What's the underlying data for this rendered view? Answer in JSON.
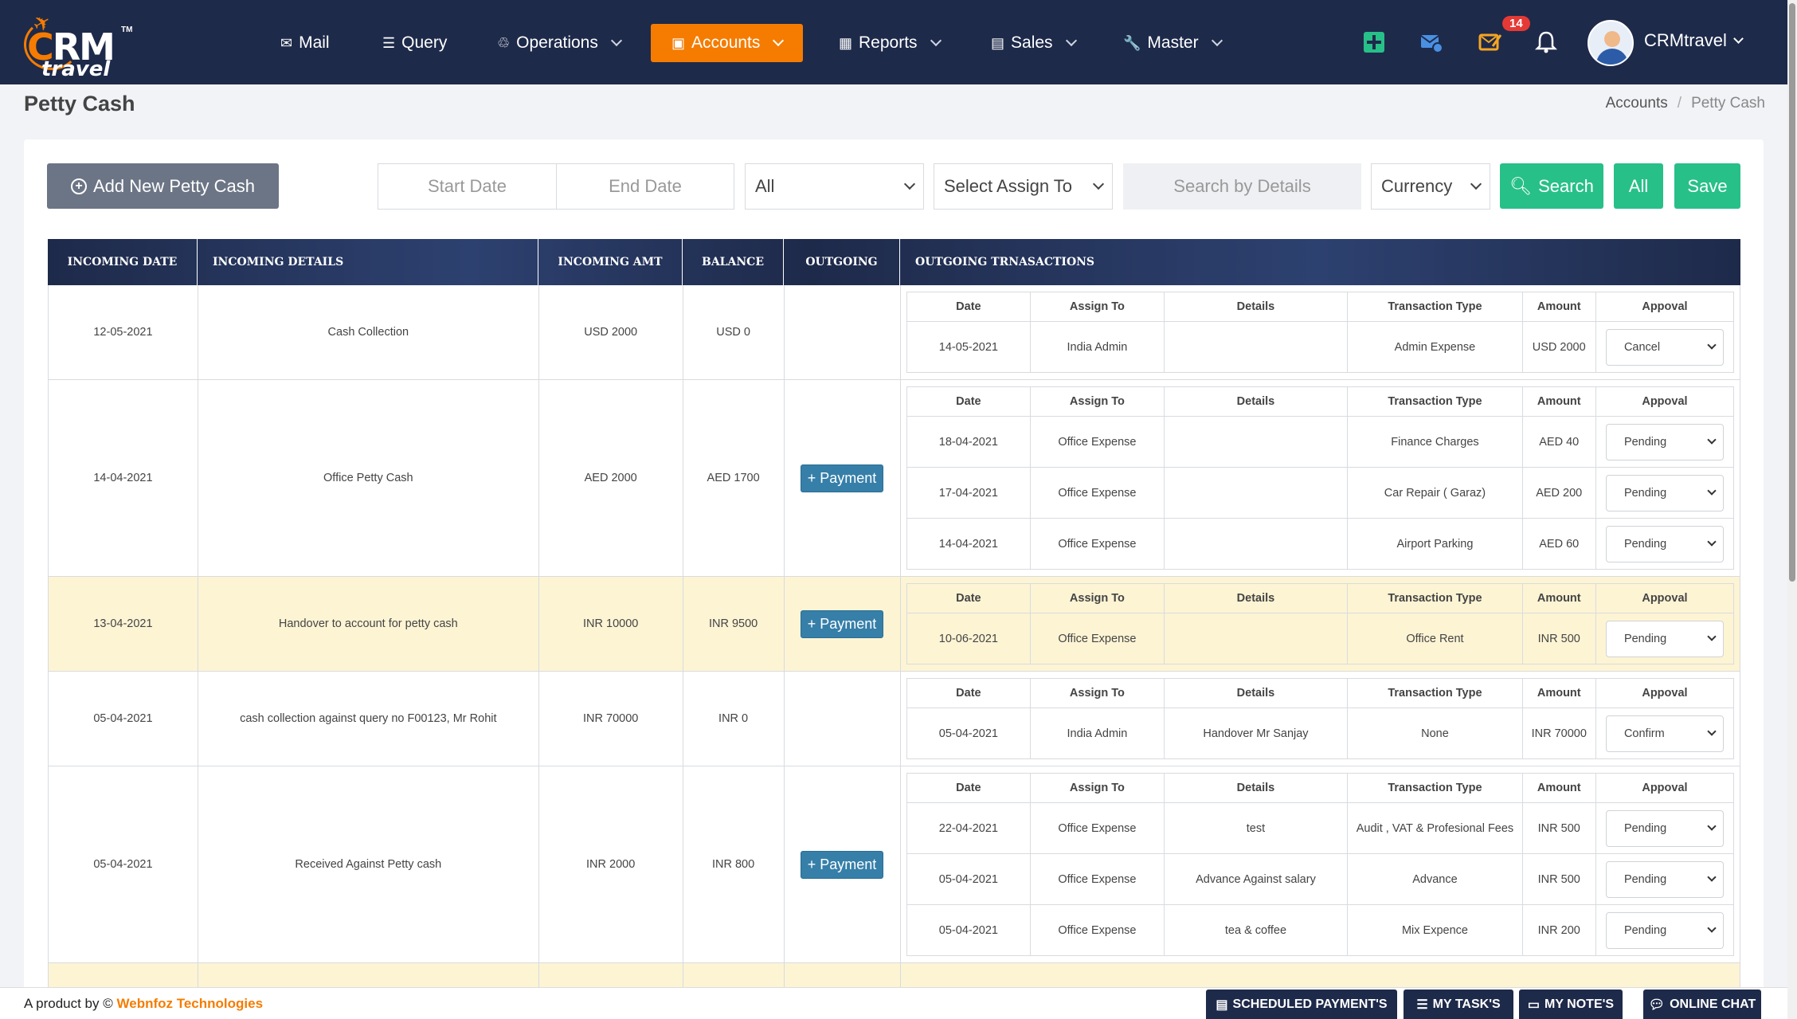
{
  "app": {
    "brand_mark": "CRM",
    "brand_sub": "travel",
    "brand_tm": "TM"
  },
  "nav": {
    "items": [
      {
        "label": "Mail",
        "icon": "mail-icon"
      },
      {
        "label": "Query",
        "icon": "list-icon"
      },
      {
        "label": "Operations",
        "icon": "recycle-icon"
      },
      {
        "label": "Accounts",
        "icon": "ledger-icon",
        "active": true
      },
      {
        "label": "Reports",
        "icon": "table-icon"
      },
      {
        "label": "Sales",
        "icon": "sales-icon"
      },
      {
        "label": "Master",
        "icon": "wrench-icon"
      }
    ],
    "notifications_count": "14",
    "user_name": "CRMtravel"
  },
  "page": {
    "title": "Petty Cash"
  },
  "breadcrumb": {
    "parent": "Accounts",
    "current": "Petty Cash"
  },
  "filters": {
    "add_label": "Add New Petty Cash",
    "start_date_placeholder": "Start Date",
    "end_date_placeholder": "End Date",
    "status_selected": "All",
    "assign_selected": "Select Assign To",
    "search_placeholder": "Search by Details",
    "currency_selected": "Currency",
    "search_label": "Search",
    "all_label": "All",
    "save_label": "Save"
  },
  "table": {
    "headers": [
      "INCOMING DATE",
      "INCOMING DETAILS",
      "INCOMING AMT",
      "BALANCE",
      "OUTGOING",
      "OUTGOING TRNASACTIONS"
    ],
    "sub_headers": [
      "Date",
      "Assign To",
      "Details",
      "Transaction Type",
      "Amount",
      "Appoval"
    ],
    "payment_label": "+ Payment",
    "rows": [
      {
        "date": "12-05-2021",
        "details": "Cash Collection",
        "amount": "USD 2000",
        "balance": "USD 0",
        "highlight": false,
        "payment": false,
        "tx": [
          [
            "14-05-2021",
            "India Admin",
            "",
            "Admin Expense",
            "USD 2000",
            "Cancel"
          ]
        ]
      },
      {
        "date": "14-04-2021",
        "details": "Office Petty Cash",
        "amount": "AED 2000",
        "balance": "AED 1700",
        "highlight": false,
        "payment": true,
        "tx": [
          [
            "18-04-2021",
            "Office Expense",
            "",
            "Finance Charges",
            "AED 40",
            "Pending"
          ],
          [
            "17-04-2021",
            "Office Expense",
            "",
            "Car Repair ( Garaz)",
            "AED 200",
            "Pending"
          ],
          [
            "14-04-2021",
            "Office Expense",
            "",
            "Airport Parking",
            "AED 60",
            "Pending"
          ]
        ]
      },
      {
        "date": "13-04-2021",
        "details": "Handover to account for petty cash",
        "amount": "INR 10000",
        "balance": "INR 9500",
        "highlight": true,
        "payment": true,
        "tx": [
          [
            "10-06-2021",
            "Office Expense",
            "",
            "Office Rent",
            "INR 500",
            "Pending"
          ]
        ]
      },
      {
        "date": "05-04-2021",
        "details": "cash collection against query no F00123, Mr Rohit",
        "amount": "INR 70000",
        "balance": "INR 0",
        "highlight": false,
        "payment": false,
        "tx": [
          [
            "05-04-2021",
            "India Admin",
            "Handover Mr Sanjay",
            "None",
            "INR 70000",
            "Confirm"
          ]
        ]
      },
      {
        "date": "05-04-2021",
        "details": "Received Against Petty cash",
        "amount": "INR 2000",
        "balance": "INR 800",
        "highlight": false,
        "payment": true,
        "tx": [
          [
            "22-04-2021",
            "Office Expense",
            "test",
            "Audit , VAT & Profesional Fees",
            "INR 500",
            "Pending"
          ],
          [
            "05-04-2021",
            "Office Expense",
            "Advance Against salary",
            "Advance",
            "INR 500",
            "Pending"
          ],
          [
            "05-04-2021",
            "Office Expense",
            "tea & coffee",
            "Mix Expence",
            "INR 200",
            "Pending"
          ]
        ]
      },
      {
        "date": "",
        "details": "",
        "amount": "",
        "balance": "",
        "highlight": true,
        "payment": false,
        "tx": []
      }
    ]
  },
  "footer": {
    "credit_prefix": "A product by ©",
    "credit_brand": "Webnfoz Technologies",
    "buttons": [
      "SCHEDULED PAYMENT'S",
      "MY TASK'S",
      "MY NOTE'S",
      "ONLINE CHAT"
    ]
  },
  "colors": {
    "nav_bg": "#1e2a4a",
    "accent": "#f57c00",
    "green": "#27c088",
    "payment_btn": "#367fa9",
    "highlight_row": "#fdf4d4"
  }
}
